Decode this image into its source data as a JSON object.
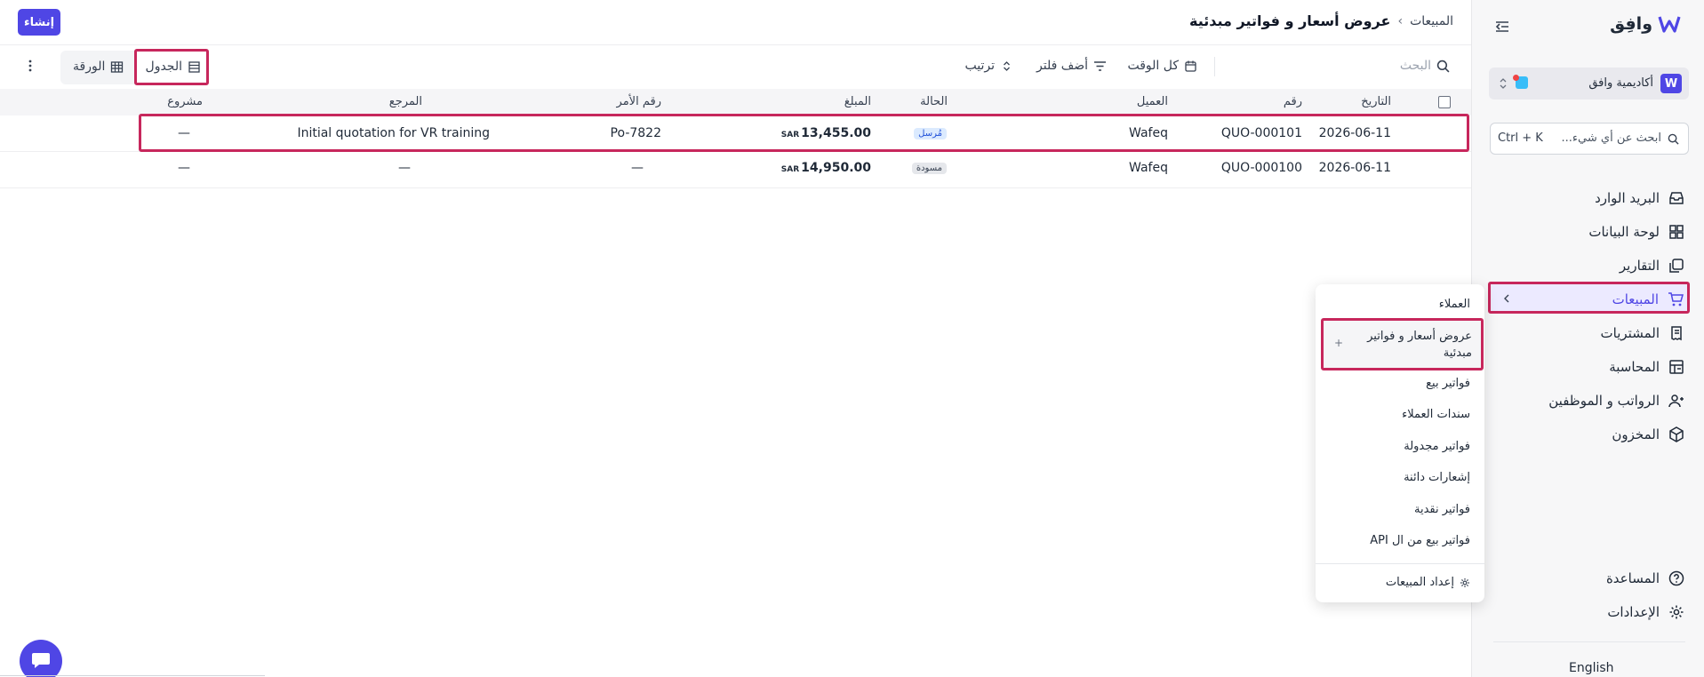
{
  "app": {
    "brand": "وافِق",
    "org_name": "أكاديمية وافق",
    "lang_toggle": "English"
  },
  "search": {
    "placeholder": "ابحث عن أي شيء...",
    "shortcut": "Ctrl + K"
  },
  "sidebar": {
    "items": [
      {
        "label": "البريد الوارد",
        "icon": "inbox-icon"
      },
      {
        "label": "لوحة البيانات",
        "icon": "dashboard-icon"
      },
      {
        "label": "التقارير",
        "icon": "reports-icon"
      },
      {
        "label": "المبيعات",
        "icon": "cart-icon"
      },
      {
        "label": "المشتريات",
        "icon": "purchases-icon"
      },
      {
        "label": "المحاسبة",
        "icon": "accounting-icon"
      },
      {
        "label": "الرواتب و الموظفين",
        "icon": "employees-icon"
      },
      {
        "label": "المخزون",
        "icon": "inventory-icon"
      }
    ],
    "bottom": [
      {
        "label": "المساعدة",
        "icon": "help-icon"
      },
      {
        "label": "الإعدادات",
        "icon": "settings-icon"
      }
    ]
  },
  "submenu": {
    "items": [
      "العملاء",
      "عروض أسعار و فواتير مبدئية",
      "فواتير بيع",
      "سندات العملاء",
      "فواتير مجدولة",
      "إشعارات دائنة",
      "فواتير نقدية",
      "فواتير بيع من ال API"
    ],
    "add_symbol": "+",
    "settings_label": "إعداد المبيعات"
  },
  "header": {
    "breadcrumb_parent": "المبيعات",
    "breadcrumb_sep": "›",
    "page_title": "عروض أسعار و فواتير مبدئية",
    "create_label": "إنشاء"
  },
  "toolbar": {
    "search_placeholder": "البحث",
    "time_filter": "كل الوقت",
    "add_filter": "أضف فلتر",
    "sort": "ترتيب",
    "view_table": "الجدول",
    "view_sheet": "الورقة"
  },
  "table": {
    "headers": {
      "date": "التاريخ",
      "number": "رقم",
      "customer": "العميل",
      "status": "الحالة",
      "amount": "المبلغ",
      "order_no": "رقم الأمر",
      "reference": "المرجع",
      "project": "مشروع"
    },
    "currency": "SAR",
    "rows": [
      {
        "date": "2026-06-11",
        "number": "QUO-000101",
        "customer": "Wafeq",
        "status": "مُرسل",
        "amount": "13,455.00",
        "order_no": "Po-7822",
        "reference": "Initial quotation for VR training",
        "project": "—"
      },
      {
        "date": "2026-06-11",
        "number": "QUO-000100",
        "customer": "Wafeq",
        "status": "مسودة",
        "amount": "14,950.00",
        "order_no": "—",
        "reference": "—",
        "project": "—"
      }
    ]
  },
  "colors": {
    "accent": "#4f46e5",
    "highlight": "#c7275c",
    "status_sent_bg": "#dbeafe",
    "status_sent_fg": "#1d4ed8",
    "status_draft_bg": "#e5e7eb"
  }
}
